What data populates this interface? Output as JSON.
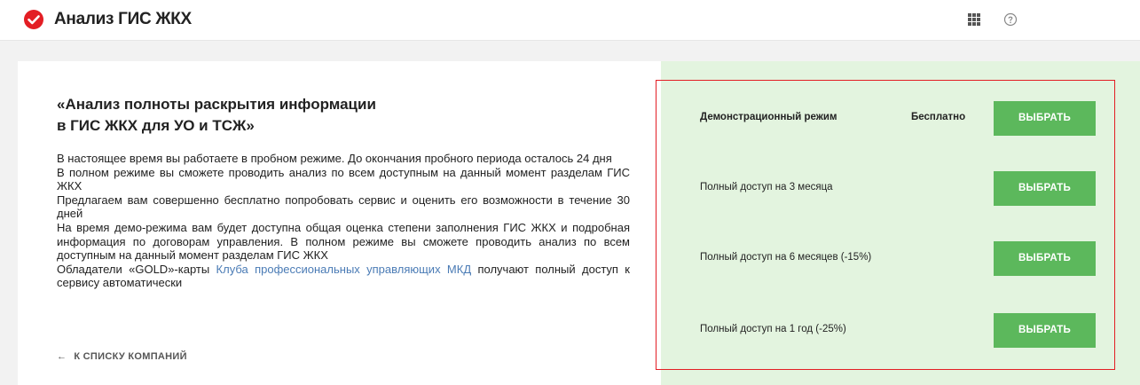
{
  "header": {
    "app_title": "Анализ ГИС ЖКХ",
    "logo_icon": "checkmark-circle-icon",
    "apps_icon": "apps-grid-icon",
    "help_icon": "help-circle-icon",
    "brand_color": "#e31e24"
  },
  "intro": {
    "title_line1": "«Анализ полноты раскрытия информации",
    "title_line2": "в ГИС ЖКХ для УО и ТСЖ»",
    "para1": "В настоящее время вы работаете в пробном режиме. До окончания пробного периода осталось 24 дня",
    "para2": "В полном режиме вы сможете проводить анализ по всем доступным на данный момент разделам ГИС ЖКХ",
    "para3": "Предлагаем вам совершенно бесплатно попробовать сервис и оценить его возможности в течение 30 дней",
    "para4": "На время демо-режима вам будет доступна общая оценка степени заполнения ГИС ЖКХ и подробная информация по договорам управления. В полном режиме вы сможете проводить анализ по всем доступным на данный момент разделам ГИС ЖКХ",
    "para5_before": "Обладатели «GOLD»-карты ",
    "para5_link": "Клуба профессиональных управляющих МКД",
    "para5_after": " получают полный доступ к сервису автоматически",
    "back_link": "К СПИСКУ КОМПАНИЙ",
    "link_color": "#4a7bb5"
  },
  "plans": [
    {
      "label": "Демонстрационный режим",
      "price": "Бесплатно",
      "button": "ВЫБРАТЬ"
    },
    {
      "label": "Полный доступ на 3 месяца",
      "price": "",
      "button": "ВЫБРАТЬ"
    },
    {
      "label": "Полный доступ на 6 месяцев (-15%)",
      "price": "",
      "button": "ВЫБРАТЬ"
    },
    {
      "label": "Полный доступ на 1 год (-25%)",
      "price": "",
      "button": "ВЫБРАТЬ"
    }
  ],
  "colors": {
    "button_green": "#5cb85c",
    "panel_green": "#e3f4df",
    "highlight_border": "#e31e24"
  }
}
